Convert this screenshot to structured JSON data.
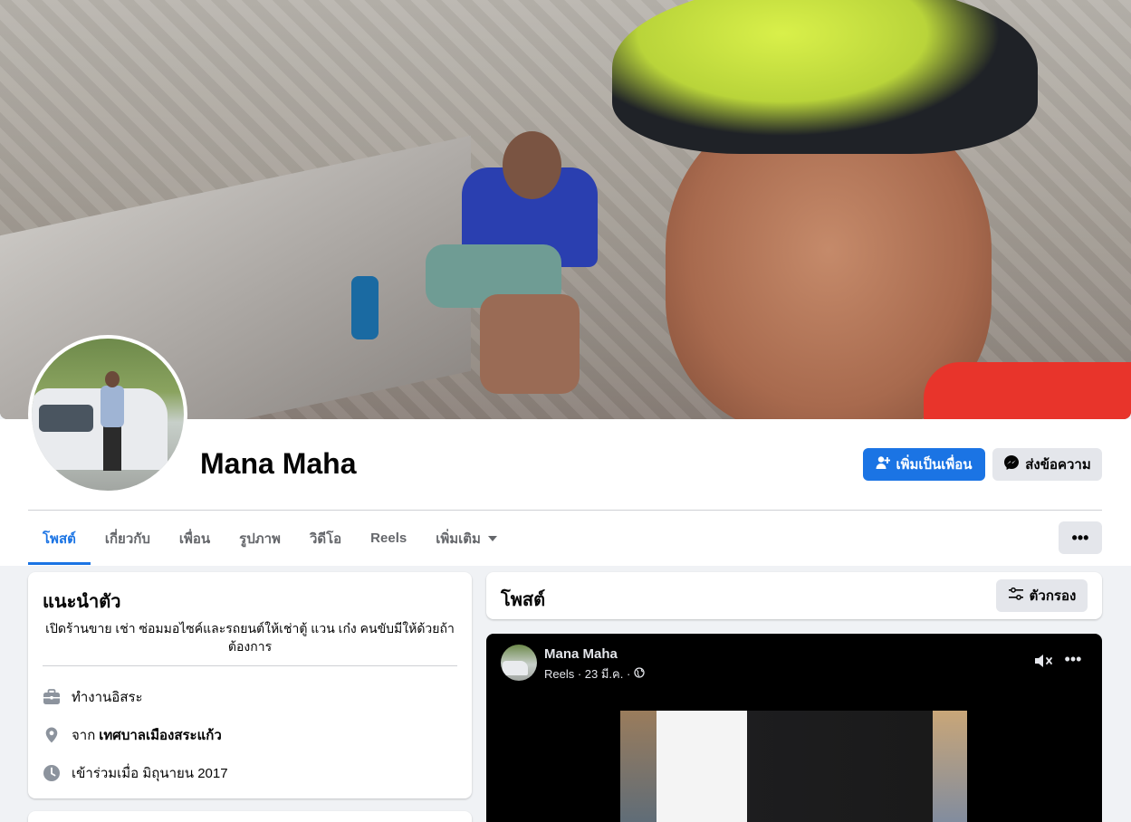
{
  "profile": {
    "name": "Mana Maha",
    "add_friend_label": "เพิ่มเป็นเพื่อน",
    "message_label": "ส่งข้อความ",
    "more_label": "•••"
  },
  "tabs": {
    "posts": "โพสต์",
    "about": "เกี่ยวกับ",
    "friends": "เพื่อน",
    "photos": "รูปภาพ",
    "videos": "วิดีโอ",
    "reels": "Reels",
    "more": "เพิ่มเติม"
  },
  "intro": {
    "title": "แนะนำตัว",
    "bio": "เปิดร้านขาย เช่า ซ่อมมอไซค์และรถยนต์ให้เช่าตู้ แวน เก๋ง คนขับมีให้ด้วยถ้าต้องการ",
    "work": "ทำงานอิสระ",
    "from_prefix": "จาก",
    "from_place": "เทศบาลเมืองสระแก้ว",
    "joined": "เข้าร่วมเมื่อ มิถุนายน 2017"
  },
  "posts": {
    "title": "โพสต์",
    "filter_label": "ตัวกรอง"
  },
  "post": {
    "author": "Mana Maha",
    "meta": "Reels · 23 มี.ค. ·",
    "more_label": "•••"
  },
  "colors": {
    "accent": "#1b74e4",
    "button_gray": "#e4e6eb",
    "background": "#f0f2f5"
  },
  "icons": {
    "add_friend": "add-person-icon",
    "messenger": "messenger-icon",
    "work": "briefcase-icon",
    "location": "location-pin-icon",
    "clock": "clock-icon",
    "filter": "filter-sliders-icon",
    "globe": "globe-icon",
    "mute": "speaker-muted-icon"
  }
}
